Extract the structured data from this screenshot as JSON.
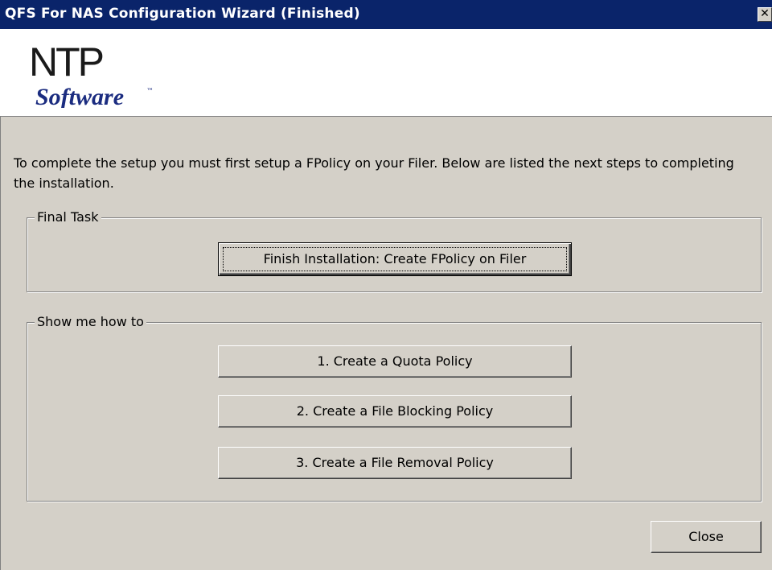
{
  "window": {
    "title": "QFS For NAS Configuration Wizard  (Finished)",
    "close_glyph": "✕"
  },
  "logo": {
    "line1": "NTP",
    "line2": "Software",
    "trademark": "™"
  },
  "intro_text": "To complete the setup you must first setup a FPolicy on your Filer. Below are listed the next steps to completing the installation.",
  "final_task": {
    "legend": "Final Task",
    "button_label": "Finish Installation: Create FPolicy on Filer"
  },
  "show_me": {
    "legend": "Show me how to",
    "buttons": [
      {
        "label": "1. Create a Quota Policy"
      },
      {
        "label": "2. Create a File Blocking Policy"
      },
      {
        "label": "3. Create a File Removal Policy"
      }
    ]
  },
  "footer": {
    "close_label": "Close"
  },
  "colors": {
    "titlebar": "#0a246a",
    "dialog_bg": "#d4d0c8",
    "logo_text": "#1b2c80"
  }
}
